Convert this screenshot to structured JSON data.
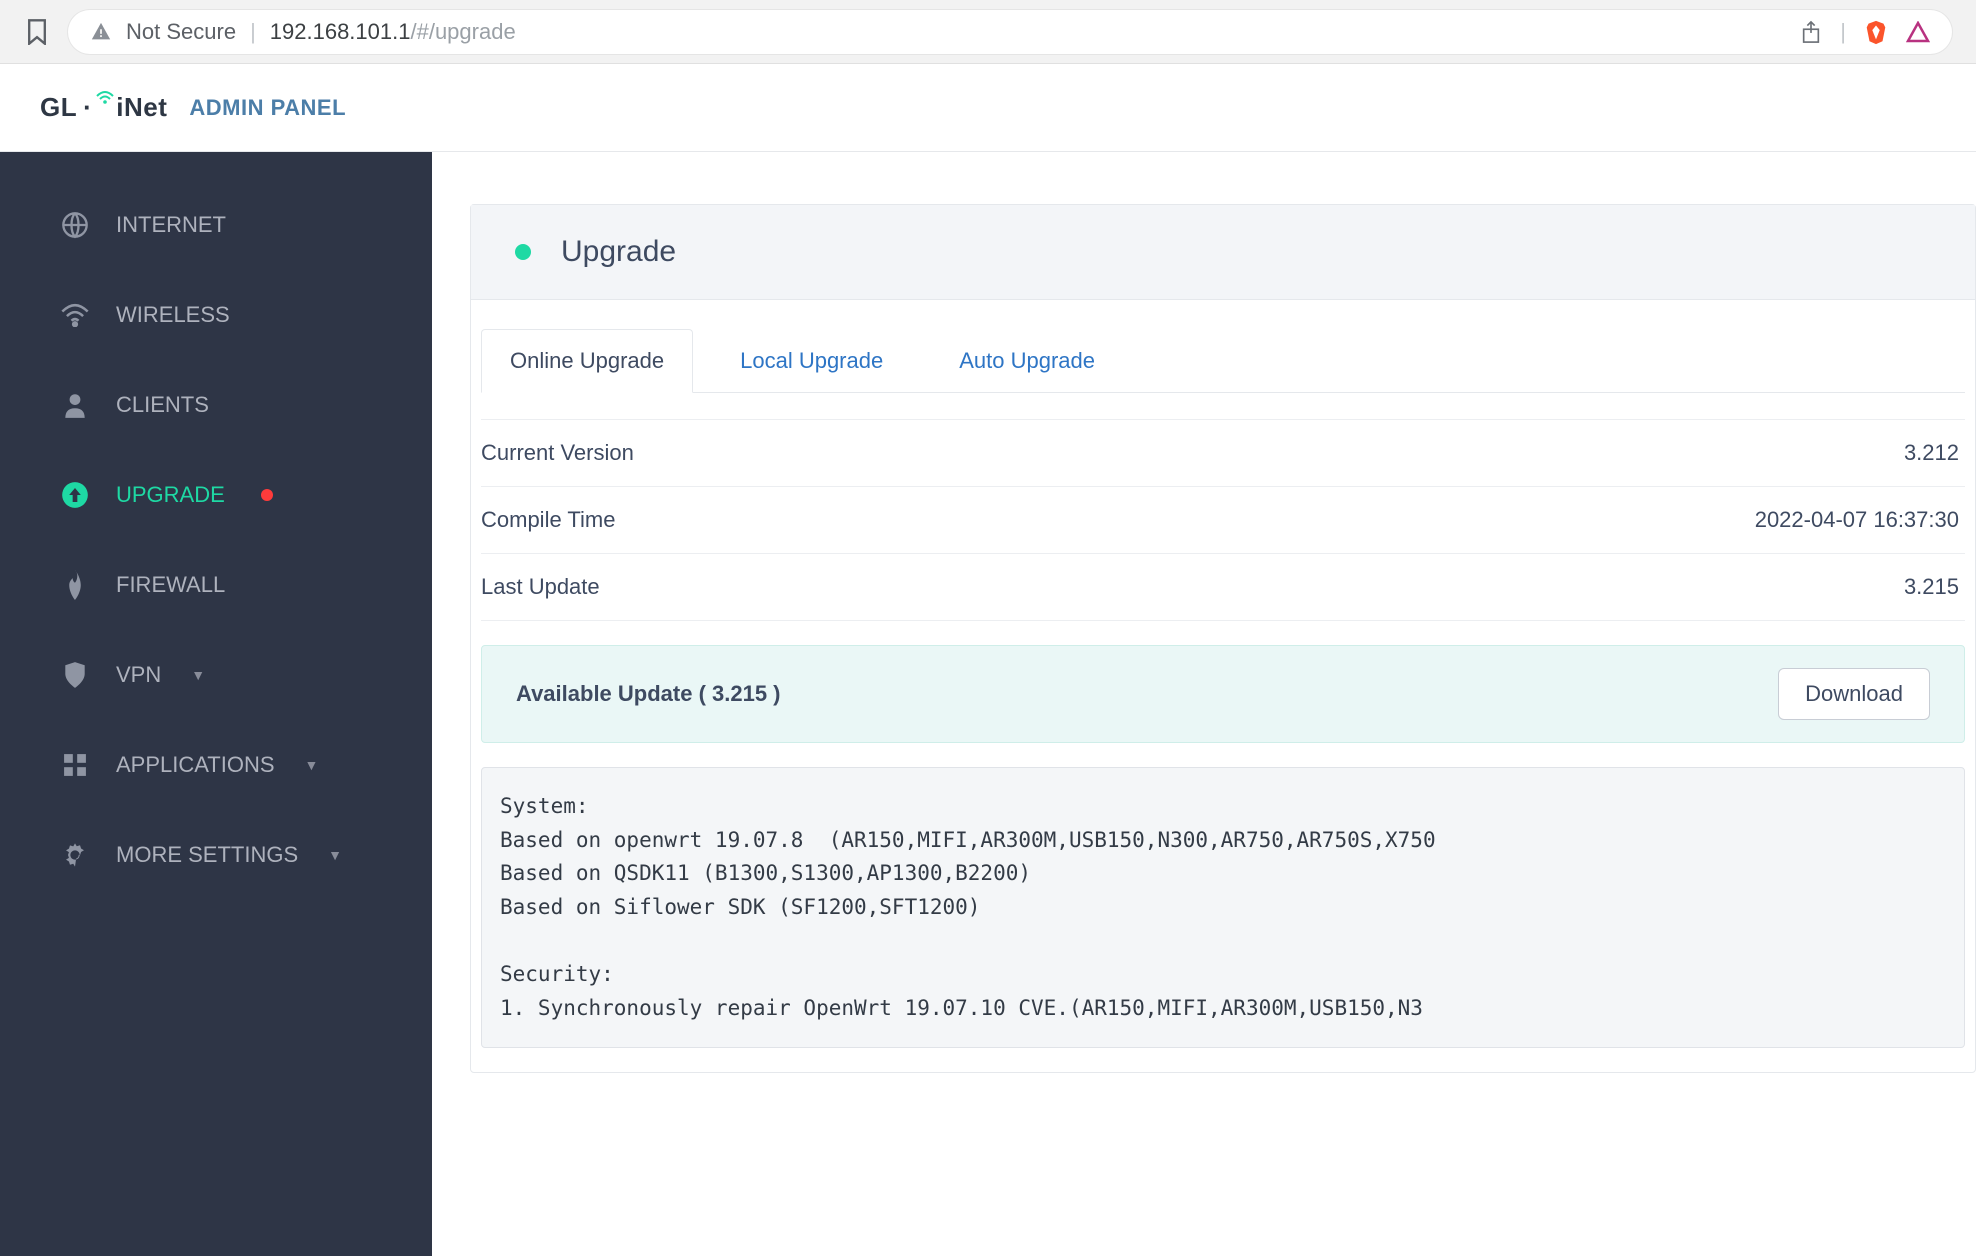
{
  "browser": {
    "not_secure_label": "Not Secure",
    "url_host": "192.168.101.1",
    "url_path": "/#/upgrade"
  },
  "header": {
    "brand_part1": "GL",
    "brand_part2": "iNet",
    "admin_label": "ADMIN PANEL"
  },
  "sidebar": {
    "items": [
      {
        "label": "INTERNET",
        "icon": "globe-icon",
        "active": false,
        "has_dot": false,
        "has_chevron": false
      },
      {
        "label": "WIRELESS",
        "icon": "wifi-icon",
        "active": false,
        "has_dot": false,
        "has_chevron": false
      },
      {
        "label": "CLIENTS",
        "icon": "user-icon",
        "active": false,
        "has_dot": false,
        "has_chevron": false
      },
      {
        "label": "UPGRADE",
        "icon": "upgrade-icon",
        "active": true,
        "has_dot": true,
        "has_chevron": false
      },
      {
        "label": "FIREWALL",
        "icon": "firewall-icon",
        "active": false,
        "has_dot": false,
        "has_chevron": false
      },
      {
        "label": "VPN",
        "icon": "shield-icon",
        "active": false,
        "has_dot": false,
        "has_chevron": true
      },
      {
        "label": "APPLICATIONS",
        "icon": "apps-icon",
        "active": false,
        "has_dot": false,
        "has_chevron": true
      },
      {
        "label": "MORE SETTINGS",
        "icon": "gear-icon",
        "active": false,
        "has_dot": false,
        "has_chevron": true
      }
    ]
  },
  "page": {
    "title": "Upgrade",
    "tabs": [
      {
        "label": "Online Upgrade",
        "active": true
      },
      {
        "label": "Local Upgrade",
        "active": false
      },
      {
        "label": "Auto Upgrade",
        "active": false
      }
    ],
    "rows": [
      {
        "label": "Current Version",
        "value": "3.212"
      },
      {
        "label": "Compile Time",
        "value": "2022-04-07 16:37:30"
      },
      {
        "label": "Last Update",
        "value": "3.215"
      }
    ],
    "available": {
      "label": "Available Update ( 3.215 )",
      "button": "Download"
    },
    "changelog": "System:\nBased on openwrt 19.07.8  (AR150,MIFI,AR300M,USB150,N300,AR750,AR750S,X750\nBased on QSDK11 (B1300,S1300,AP1300,B2200)\nBased on Siflower SDK (SF1200,SFT1200)\n\nSecurity:\n1. Synchronously repair OpenWrt 19.07.10 CVE.(AR150,MIFI,AR300M,USB150,N3"
  }
}
